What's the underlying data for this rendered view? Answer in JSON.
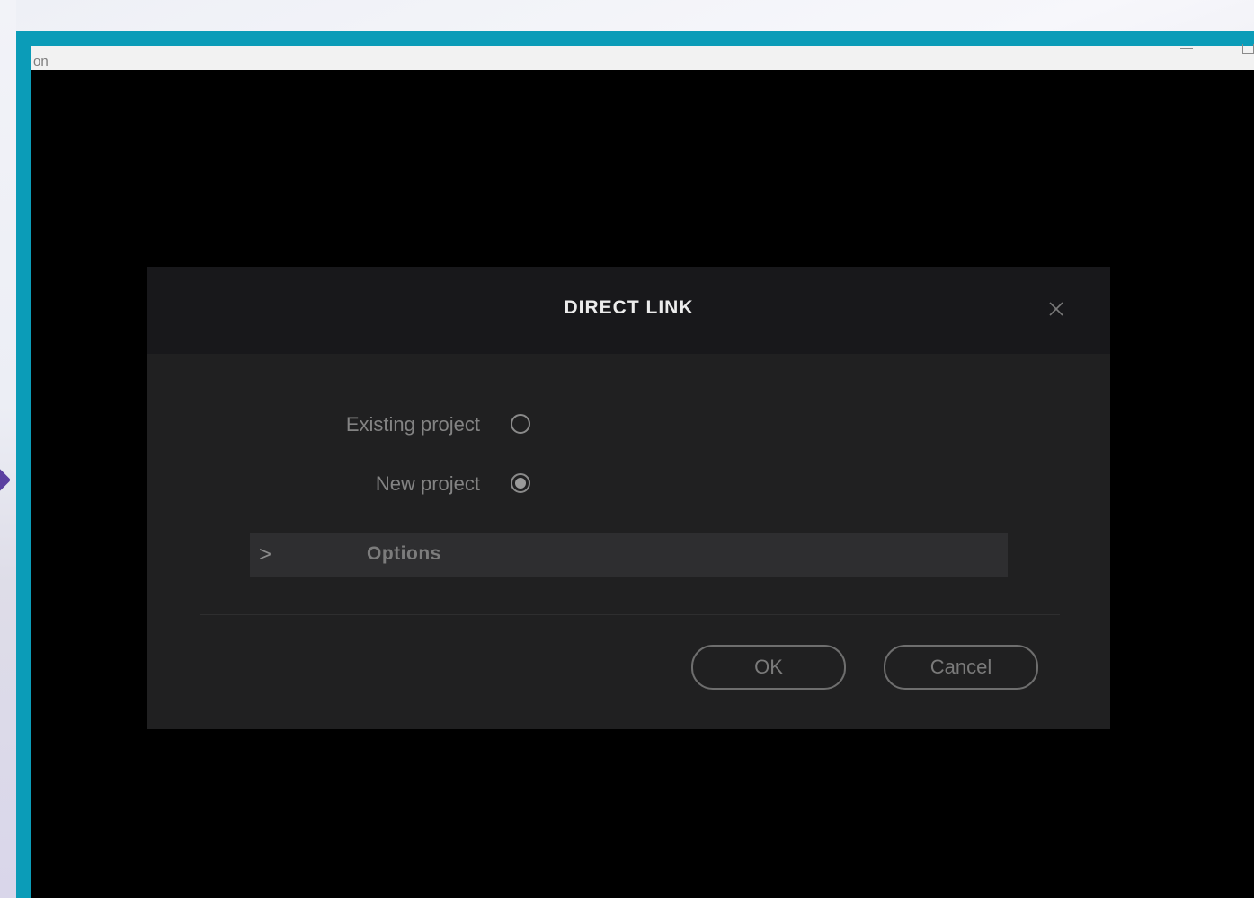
{
  "window": {
    "title": "on"
  },
  "dialog": {
    "title": "DIRECT LINK",
    "radios": [
      {
        "label": "Existing project",
        "checked": false
      },
      {
        "label": "New project",
        "checked": true
      }
    ],
    "options": {
      "chevron": ">",
      "label": "Options"
    },
    "buttons": {
      "ok_label": "OK",
      "cancel_label": "Cancel"
    }
  },
  "icons": {
    "close": "close-icon",
    "minimize": "minimize-icon",
    "maximize": "maximize-icon"
  },
  "colors": {
    "window_frame": "#0b9cb8",
    "dialog_background": "#202021",
    "dialog_header": "#18181b",
    "options_bar": "#2e2e30"
  }
}
